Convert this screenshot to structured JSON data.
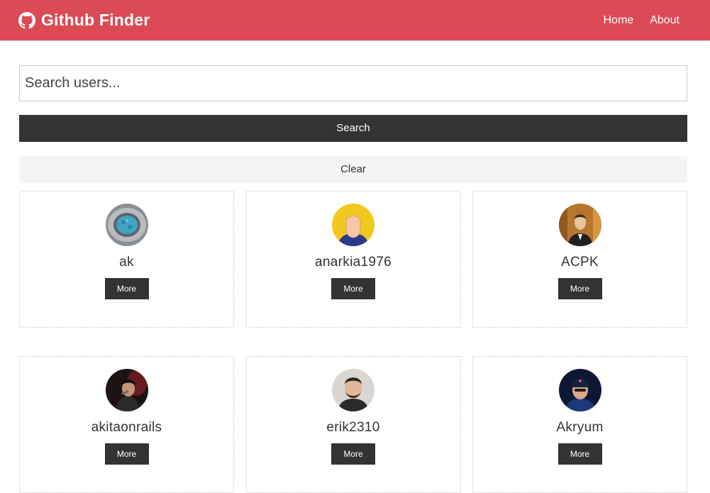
{
  "navbar": {
    "brand_icon": "github-icon",
    "brand_title": "Github Finder",
    "links": [
      "Home",
      "About"
    ],
    "color": "#dc4a55"
  },
  "search": {
    "placeholder": "Search users...",
    "value": "",
    "search_label": "Search",
    "clear_label": "Clear"
  },
  "users": [
    {
      "login": "ak",
      "more_label": "More"
    },
    {
      "login": "anarkia1976",
      "more_label": "More"
    },
    {
      "login": "ACPK",
      "more_label": "More"
    },
    {
      "login": "akitaonrails",
      "more_label": "More"
    },
    {
      "login": "erik2310",
      "more_label": "More"
    },
    {
      "login": "Akryum",
      "more_label": "More"
    }
  ]
}
